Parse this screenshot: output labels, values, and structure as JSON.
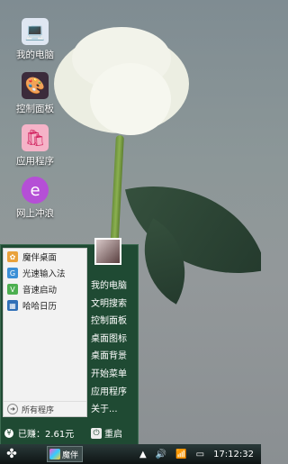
{
  "desktop_icons": [
    {
      "label": "我的电脑",
      "icon": "computer-icon"
    },
    {
      "label": "控制面板",
      "icon": "control-panel-icon"
    },
    {
      "label": "应用程序",
      "icon": "shopping-bag-icon"
    },
    {
      "label": "网上冲浪",
      "icon": "browser-icon"
    }
  ],
  "start_menu": {
    "programs": [
      {
        "label": "魔伴桌面",
        "color": "#e9a23b"
      },
      {
        "label": "光速输入法",
        "color": "#3a8fd6"
      },
      {
        "label": "音速启动",
        "color": "#4caf50"
      },
      {
        "label": "哈哈日历",
        "color": "#2f6fb7"
      }
    ],
    "all_programs": "所有程序",
    "right_items": [
      "我的电脑",
      "文明搜索",
      "控制面板",
      "桌面图标",
      "桌面背景",
      "开始菜单",
      "应用程序",
      "关于..."
    ],
    "earned": "已赚：2.61元",
    "restart": "重启"
  },
  "taskbar": {
    "task_label": "魔伴",
    "clock": "17:12:32"
  }
}
